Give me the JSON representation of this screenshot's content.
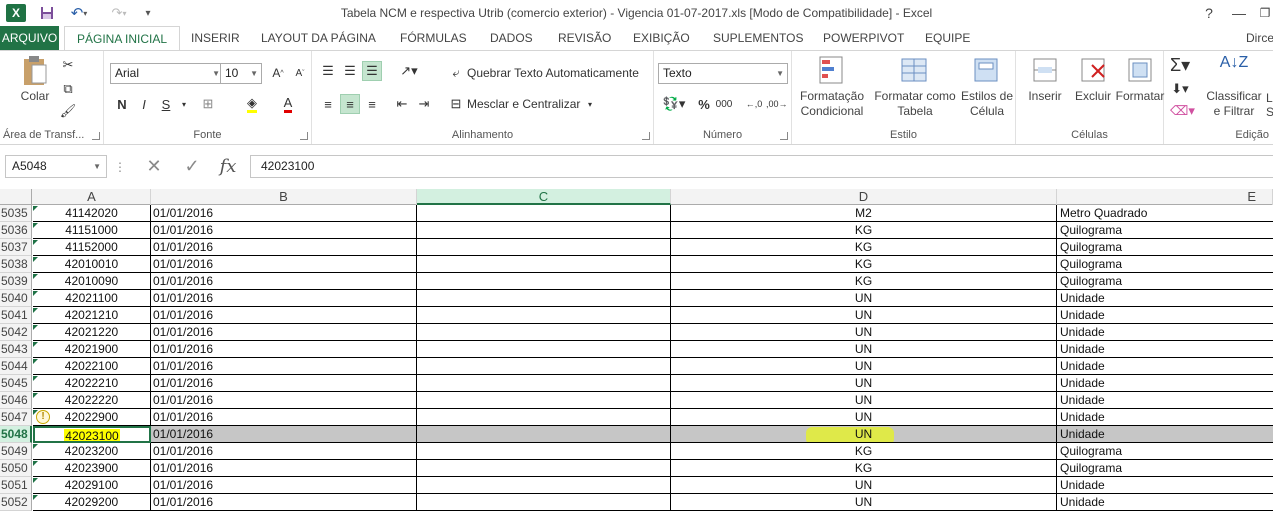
{
  "window": {
    "title": "Tabela NCM e respectiva Utrib (comercio exterior) - Vigencia 01-07-2017.xls  [Modo de Compatibilidade] - Excel",
    "help": "?",
    "minimize": "—",
    "restore": "❐"
  },
  "quick_access": {
    "logo": "X",
    "save": "💾",
    "undo": "↶",
    "redo": "↷",
    "customize": "▾"
  },
  "tabs": [
    {
      "label": "ARQUIVO"
    },
    {
      "label": "PÁGINA INICIAL"
    },
    {
      "label": "INSERIR"
    },
    {
      "label": "LAYOUT DA PÁGINA"
    },
    {
      "label": "FÓRMULAS"
    },
    {
      "label": "DADOS"
    },
    {
      "label": "REVISÃO"
    },
    {
      "label": "EXIBIÇÃO"
    },
    {
      "label": "SUPLEMENTOS"
    },
    {
      "label": "POWERPIVOT"
    },
    {
      "label": "EQUIPE"
    }
  ],
  "user": "Dirce",
  "ribbon": {
    "clipboard": {
      "paste": "Colar",
      "label": "Área de Transf..."
    },
    "font": {
      "name": "Arial",
      "size": "10",
      "bold": "N",
      "italic": "I",
      "underline": "S",
      "label": "Fonte"
    },
    "alignment": {
      "wrap": "Quebrar Texto Automaticamente",
      "merge": "Mesclar e Centralizar",
      "label": "Alinhamento"
    },
    "number": {
      "format": "Texto",
      "percent": "%",
      "thousands": "000",
      "label": "Número"
    },
    "styles": {
      "conditional": "Formatação Condicional",
      "table": "Formatar como Tabela",
      "cell": "Estilos de Célula",
      "label": "Estilo"
    },
    "cells": {
      "insert": "Inserir",
      "delete": "Excluir",
      "format": "Formatar",
      "label": "Células"
    },
    "editing": {
      "sort": "Classificar e Filtrar",
      "label": "Edição",
      "find": "L S"
    }
  },
  "formula_bar": {
    "name_box": "A5048",
    "fx": "fx",
    "value": "42023100"
  },
  "columns": [
    "A",
    "B",
    "C",
    "D",
    "E"
  ],
  "rows": [
    {
      "n": "5035",
      "a": "41142020",
      "b": "01/01/2016",
      "d": "M2",
      "e": "Metro Quadrado"
    },
    {
      "n": "5036",
      "a": "41151000",
      "b": "01/01/2016",
      "d": "KG",
      "e": "Quilograma"
    },
    {
      "n": "5037",
      "a": "41152000",
      "b": "01/01/2016",
      "d": "KG",
      "e": "Quilograma"
    },
    {
      "n": "5038",
      "a": "42010010",
      "b": "01/01/2016",
      "d": "KG",
      "e": "Quilograma"
    },
    {
      "n": "5039",
      "a": "42010090",
      "b": "01/01/2016",
      "d": "KG",
      "e": "Quilograma"
    },
    {
      "n": "5040",
      "a": "42021100",
      "b": "01/01/2016",
      "d": "UN",
      "e": "Unidade"
    },
    {
      "n": "5041",
      "a": "42021210",
      "b": "01/01/2016",
      "d": "UN",
      "e": "Unidade"
    },
    {
      "n": "5042",
      "a": "42021220",
      "b": "01/01/2016",
      "d": "UN",
      "e": "Unidade"
    },
    {
      "n": "5043",
      "a": "42021900",
      "b": "01/01/2016",
      "d": "UN",
      "e": "Unidade"
    },
    {
      "n": "5044",
      "a": "42022100",
      "b": "01/01/2016",
      "d": "UN",
      "e": "Unidade"
    },
    {
      "n": "5045",
      "a": "42022210",
      "b": "01/01/2016",
      "d": "UN",
      "e": "Unidade"
    },
    {
      "n": "5046",
      "a": "42022220",
      "b": "01/01/2016",
      "d": "UN",
      "e": "Unidade"
    },
    {
      "n": "5047",
      "a": "42022900",
      "b": "01/01/2016",
      "d": "UN",
      "e": "Unidade"
    },
    {
      "n": "5048",
      "a": "42023100",
      "b": "01/01/2016",
      "d": "UN",
      "e": "Unidade"
    },
    {
      "n": "5049",
      "a": "42023200",
      "b": "01/01/2016",
      "d": "KG",
      "e": "Quilograma"
    },
    {
      "n": "5050",
      "a": "42023900",
      "b": "01/01/2016",
      "d": "KG",
      "e": "Quilograma"
    },
    {
      "n": "5051",
      "a": "42029100",
      "b": "01/01/2016",
      "d": "UN",
      "e": "Unidade"
    },
    {
      "n": "5052",
      "a": "42029200",
      "b": "01/01/2016",
      "d": "UN",
      "e": "Unidade"
    }
  ],
  "selected_row": "5048",
  "colors": {
    "accent": "#217346",
    "highlight": "#ffff00",
    "row_selected": "#c6c6c6"
  }
}
